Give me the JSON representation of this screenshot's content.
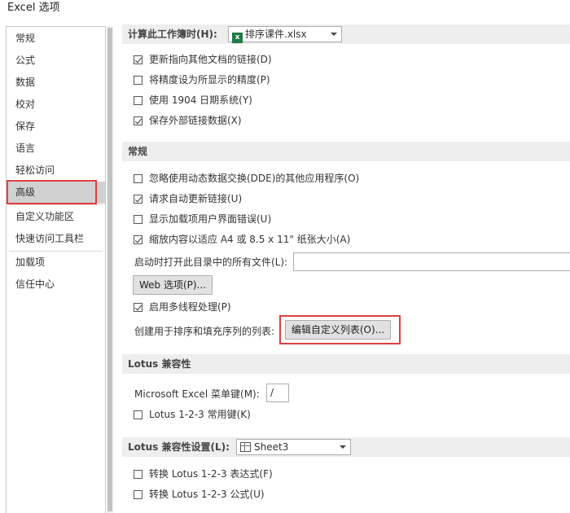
{
  "window": {
    "title": "Excel 选项"
  },
  "nav": {
    "items": [
      {
        "label": "常规"
      },
      {
        "label": "公式"
      },
      {
        "label": "数据"
      },
      {
        "label": "校对"
      },
      {
        "label": "保存"
      },
      {
        "label": "语言"
      },
      {
        "label": "轻松访问"
      },
      {
        "label": "高级"
      },
      {
        "label": "自定义功能区"
      },
      {
        "label": "快速访问工具栏"
      },
      {
        "label": "加载项"
      },
      {
        "label": "信任中心"
      }
    ],
    "selected": "高级"
  },
  "workbook_section": {
    "label": "计算此工作簿时(H):",
    "combo_value": "排序课件.xlsx",
    "options": [
      {
        "label": "更新指向其他文档的链接(D)",
        "checked": true
      },
      {
        "label": "将精度设为所显示的精度(P)",
        "checked": false
      },
      {
        "label": "使用 1904 日期系统(Y)",
        "checked": false
      },
      {
        "label": "保存外部链接数据(X)",
        "checked": true
      }
    ]
  },
  "general_section": {
    "header": "常规",
    "options": [
      {
        "label": "忽略使用动态数据交换(DDE)的其他应用程序(O)",
        "checked": false
      },
      {
        "label": "请求自动更新链接(U)",
        "checked": true
      },
      {
        "label": "显示加载项用户界面错误(U)",
        "checked": false
      },
      {
        "label": "缩放内容以适应 A4 或 8.5 x 11\" 纸张大小(A)",
        "checked": true
      }
    ],
    "startup_label": "启动时打开此目录中的所有文件(L):",
    "startup_value": "",
    "web_options_button": "Web 选项(P)...",
    "multithread": {
      "label": "启用多线程处理(P)",
      "checked": true
    },
    "custom_lists_label": "创建用于排序和填充序列的列表:",
    "custom_lists_button": "编辑自定义列表(O)..."
  },
  "lotus_section": {
    "header": "Lotus 兼容性",
    "menu_key_label": "Microsoft Excel 菜单键(M):",
    "menu_key_value": "/",
    "navigation_keys": {
      "label": "Lotus 1-2-3 常用键(K)",
      "checked": false
    }
  },
  "lotus_settings_section": {
    "header": "Lotus 兼容性设置(L):",
    "combo_value": "Sheet3",
    "options": [
      {
        "label": "转换 Lotus 1-2-3 表达式(F)",
        "checked": false
      },
      {
        "label": "转换 Lotus 1-2-3 公式(U)",
        "checked": false
      }
    ]
  },
  "colors": {
    "highlight": "#e04040",
    "selected_nav": "#d1d1d1",
    "excel_green": "#1f7a44"
  }
}
